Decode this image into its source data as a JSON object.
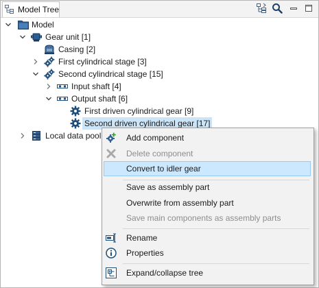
{
  "view": {
    "tab_label": "Model Tree",
    "tab_icon": "tree-view-icon",
    "toolbar_icons": [
      "link-with-selection-icon",
      "search-icon",
      "minimize-icon",
      "maximize-icon"
    ]
  },
  "tree": {
    "nodes": [
      {
        "label": "Model",
        "icon": "folder-icon",
        "expanded": true
      },
      {
        "label": "Gear unit [1]",
        "icon": "gear-unit-icon",
        "expanded": true
      },
      {
        "label": "Casing [2]",
        "icon": "casing-icon"
      },
      {
        "label": "First cylindrical stage [3]",
        "icon": "gear-stage-icon",
        "expanded": false
      },
      {
        "label": "Second cylindrical stage [15]",
        "icon": "gear-stage-icon",
        "expanded": true
      },
      {
        "label": "Input shaft [4]",
        "icon": "shaft-icon",
        "expanded": false
      },
      {
        "label": "Output shaft [6]",
        "icon": "shaft-icon",
        "expanded": true
      },
      {
        "label": "First driven cylindrical gear [9]",
        "icon": "gear-icon"
      },
      {
        "label": "Second driven cylindrical gear [17]",
        "icon": "gear-icon",
        "selected": true
      },
      {
        "label": "Local data pool",
        "icon": "data-pool-icon",
        "expanded": false
      }
    ]
  },
  "context_menu": {
    "items": [
      {
        "label": "Add component",
        "icon": "add-component-icon",
        "enabled": true
      },
      {
        "label": "Delete component",
        "icon": "delete-icon",
        "enabled": false
      },
      {
        "label": "Convert to idler gear",
        "enabled": true,
        "highlighted": true
      },
      {
        "label": "Save as assembly part",
        "enabled": true
      },
      {
        "label": "Overwrite from assembly part",
        "enabled": true
      },
      {
        "label": "Save main components as assembly parts",
        "enabled": false
      },
      {
        "label": "Rename",
        "icon": "rename-icon",
        "enabled": true
      },
      {
        "label": "Properties",
        "icon": "info-icon",
        "enabled": true
      },
      {
        "label": "Expand/collapse tree",
        "icon": "expand-collapse-icon",
        "enabled": true
      }
    ]
  },
  "colors": {
    "selection": "#cce4f7",
    "menu_highlight": "#cce8ff",
    "icon_blue": "#1f4e79",
    "disabled_text": "#8d8d8d"
  }
}
